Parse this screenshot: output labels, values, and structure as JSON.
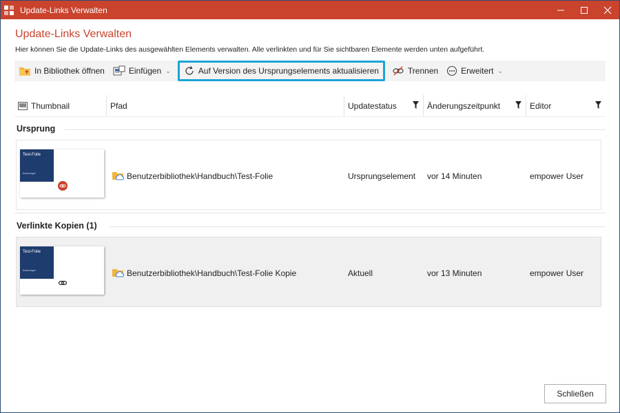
{
  "window": {
    "title": "Update-Links Verwalten"
  },
  "header": {
    "title": "Update-Links Verwalten",
    "description": "Hier können Sie die Update-Links des ausgewählten Elements verwalten. Alle verlinkten und für Sie sichtbaren Elemente werden unten aufgeführt."
  },
  "toolbar": {
    "open_library": "In Bibliothek öffnen",
    "insert": "Einfügen",
    "update": "Auf Version des Ursprungselements aktualisieren",
    "disconnect": "Trennen",
    "advanced": "Erweitert"
  },
  "columns": {
    "thumbnail": "Thumbnail",
    "path": "Pfad",
    "status": "Updatestatus",
    "changed": "Änderungszeitpunkt",
    "editor": "Editor"
  },
  "groups": {
    "origin": {
      "label": "Ursprung",
      "row": {
        "thumb_title": "Test-Folie",
        "thumb_sub": "Änderungen",
        "path": "Benutzerbibliothek\\Handbuch\\Test-Folie",
        "status": "Ursprungselement",
        "changed": "vor 14 Minuten",
        "editor": "empower User"
      }
    },
    "copies": {
      "label": "Verlinkte Kopien (1)",
      "row": {
        "thumb_title": "Test-Folie",
        "thumb_sub": "Änderungen",
        "path": "Benutzerbibliothek\\Handbuch\\Test-Folie Kopie",
        "status": "Aktuell",
        "changed": "vor 13 Minuten",
        "editor": "empower User"
      }
    }
  },
  "footer": {
    "close": "Schließen"
  },
  "colors": {
    "brand": "#c9432d",
    "highlight": "#1aa3d6",
    "slide_blue": "#1f3c6e"
  },
  "icons": {
    "app": "app-logo-icon",
    "open_library": "folder-upload-icon",
    "insert": "insert-slide-icon",
    "update": "refresh-icon",
    "disconnect": "broken-link-icon",
    "advanced": "more-icon",
    "thumbnail": "image-icon",
    "filter": "filter-icon",
    "path": "cloud-folder-icon",
    "origin_badge": "origin-link-icon",
    "copy_badge": "chain-link-icon"
  }
}
